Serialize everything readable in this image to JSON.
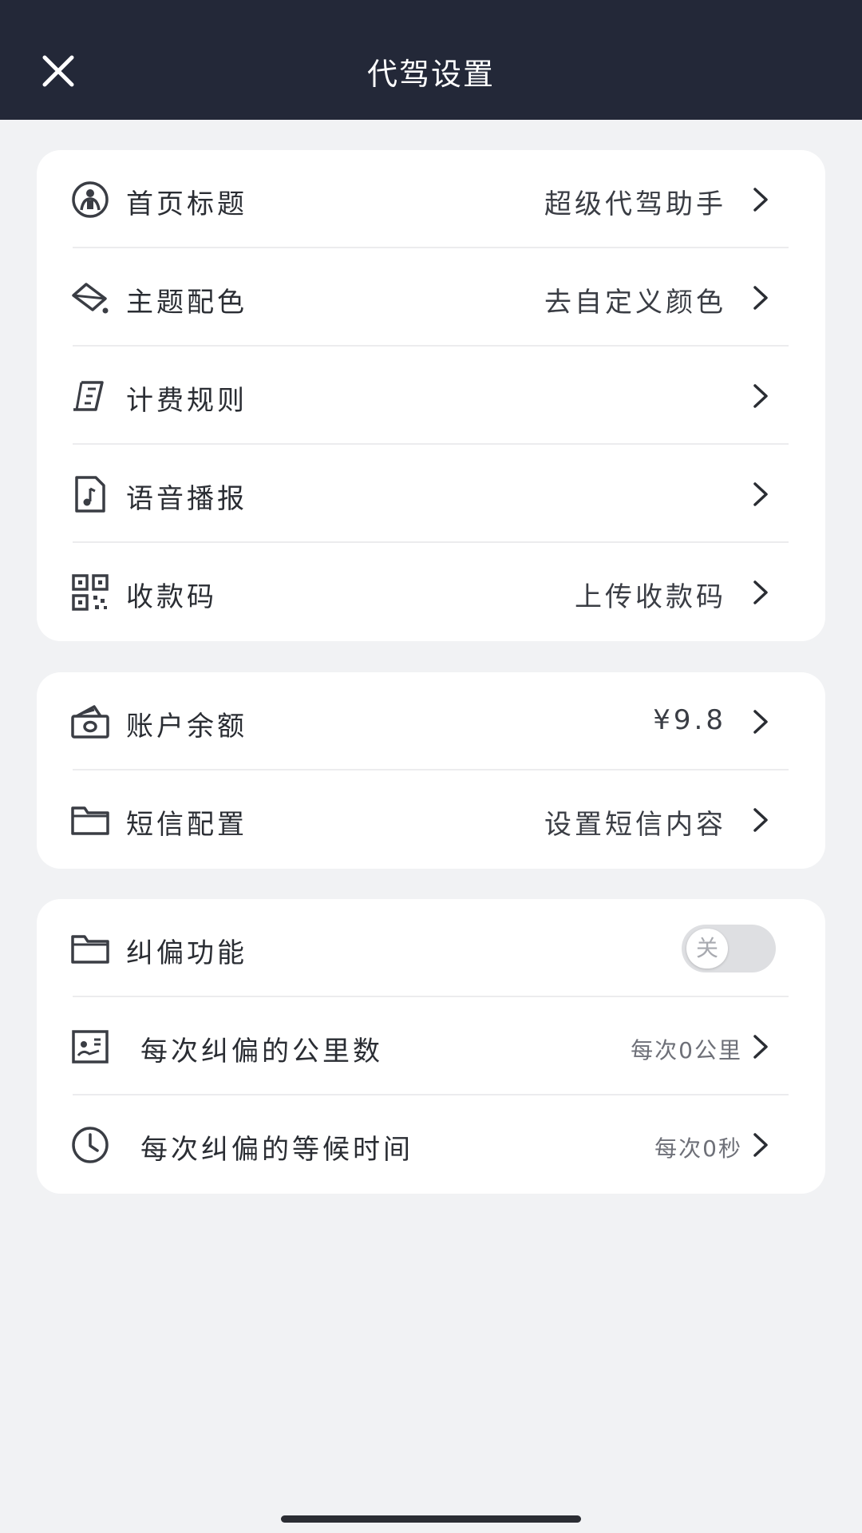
{
  "header": {
    "title": "代驾设置",
    "close_icon": "close-icon"
  },
  "card1": [
    {
      "icon": "person-circle-icon",
      "label": "首页标题",
      "value": "超级代驾助手"
    },
    {
      "icon": "paint-bucket-icon",
      "label": "主题配色",
      "value": "去自定义颜色"
    },
    {
      "icon": "ruler-icon",
      "label": "计费规则",
      "value": ""
    },
    {
      "icon": "audio-file-icon",
      "label": "语音播报",
      "value": ""
    },
    {
      "icon": "qr-code-icon",
      "label": "收款码",
      "value": "上传收款码"
    }
  ],
  "card2": [
    {
      "icon": "money-icon",
      "label": "账户余额",
      "value": "¥9.8"
    },
    {
      "icon": "folder-icon",
      "label": "短信配置",
      "value": "设置短信内容"
    }
  ],
  "card3": {
    "toggle_row": {
      "icon": "folder-icon",
      "label": "纠偏功能",
      "toggle_text": "关",
      "toggle_on": false
    },
    "rows": [
      {
        "icon": "id-card-icon",
        "label": "每次纠偏的公里数",
        "value": "每次0公里"
      },
      {
        "icon": "clock-icon",
        "label": "每次纠偏的等候时间",
        "value": "每次0秒"
      }
    ]
  },
  "colors": {
    "header_bg": "#232838",
    "page_bg": "#f1f2f4",
    "card_bg": "#ffffff"
  }
}
